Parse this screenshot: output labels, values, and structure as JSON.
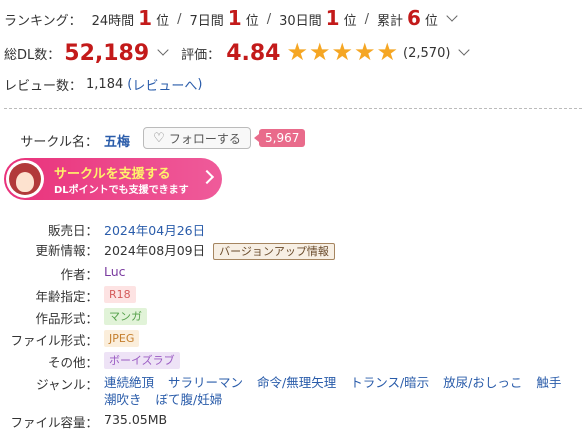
{
  "ranking": {
    "label": "ランキング：",
    "items": [
      {
        "period": "24時間",
        "rank": "1",
        "unit": "位"
      },
      {
        "period": "7日間",
        "rank": "1",
        "unit": "位"
      },
      {
        "period": "30日間",
        "rank": "1",
        "unit": "位"
      },
      {
        "period": "累計",
        "rank": "6",
        "unit": "位"
      }
    ],
    "separator": "/"
  },
  "downloads": {
    "label": "総DL数：",
    "value": "52,189"
  },
  "rating": {
    "label": "評価：",
    "value": "4.84",
    "stars": "★★★★★",
    "count": "(2,570)"
  },
  "reviews": {
    "label": "レビュー数：",
    "value": "1,184",
    "link_open": "(",
    "link": "レビューへ",
    "link_close": ")"
  },
  "circle": {
    "label": "サークル名：",
    "name": "五梅",
    "follow_label": "フォローする",
    "follow_count": "5,967"
  },
  "support": {
    "title": "サークルを支援する",
    "subtitle": "DLポイントでも支援できます"
  },
  "specs": {
    "release_label": "販売日：",
    "release_value": "2024年04月26日",
    "update_label": "更新情報：",
    "update_value": "2024年08月09日",
    "update_badge": "バージョンアップ情報",
    "author_label": "作者：",
    "author_value": "Luc",
    "age_label": "年齢指定：",
    "age_value": "R18",
    "format_label": "作品形式：",
    "format_value": "マンガ",
    "file_format_label": "ファイル形式：",
    "file_format_value": "JPEG",
    "other_label": "その他：",
    "other_value": "ボーイズラブ",
    "genre_label": "ジャンル：",
    "genres": [
      "連続絶頂",
      "サラリーマン",
      "命令/無理矢理",
      "トランス/暗示",
      "放尿/おしっこ",
      "触手",
      "潮吹き",
      "ぼて腹/妊婦"
    ],
    "size_label": "ファイル容量：",
    "size_value": "735.05MB"
  },
  "colors": {
    "accent_red": "#c31a1a",
    "star": "#f5a623",
    "link": "#2a5caa",
    "support_pink": "#e9327b"
  }
}
